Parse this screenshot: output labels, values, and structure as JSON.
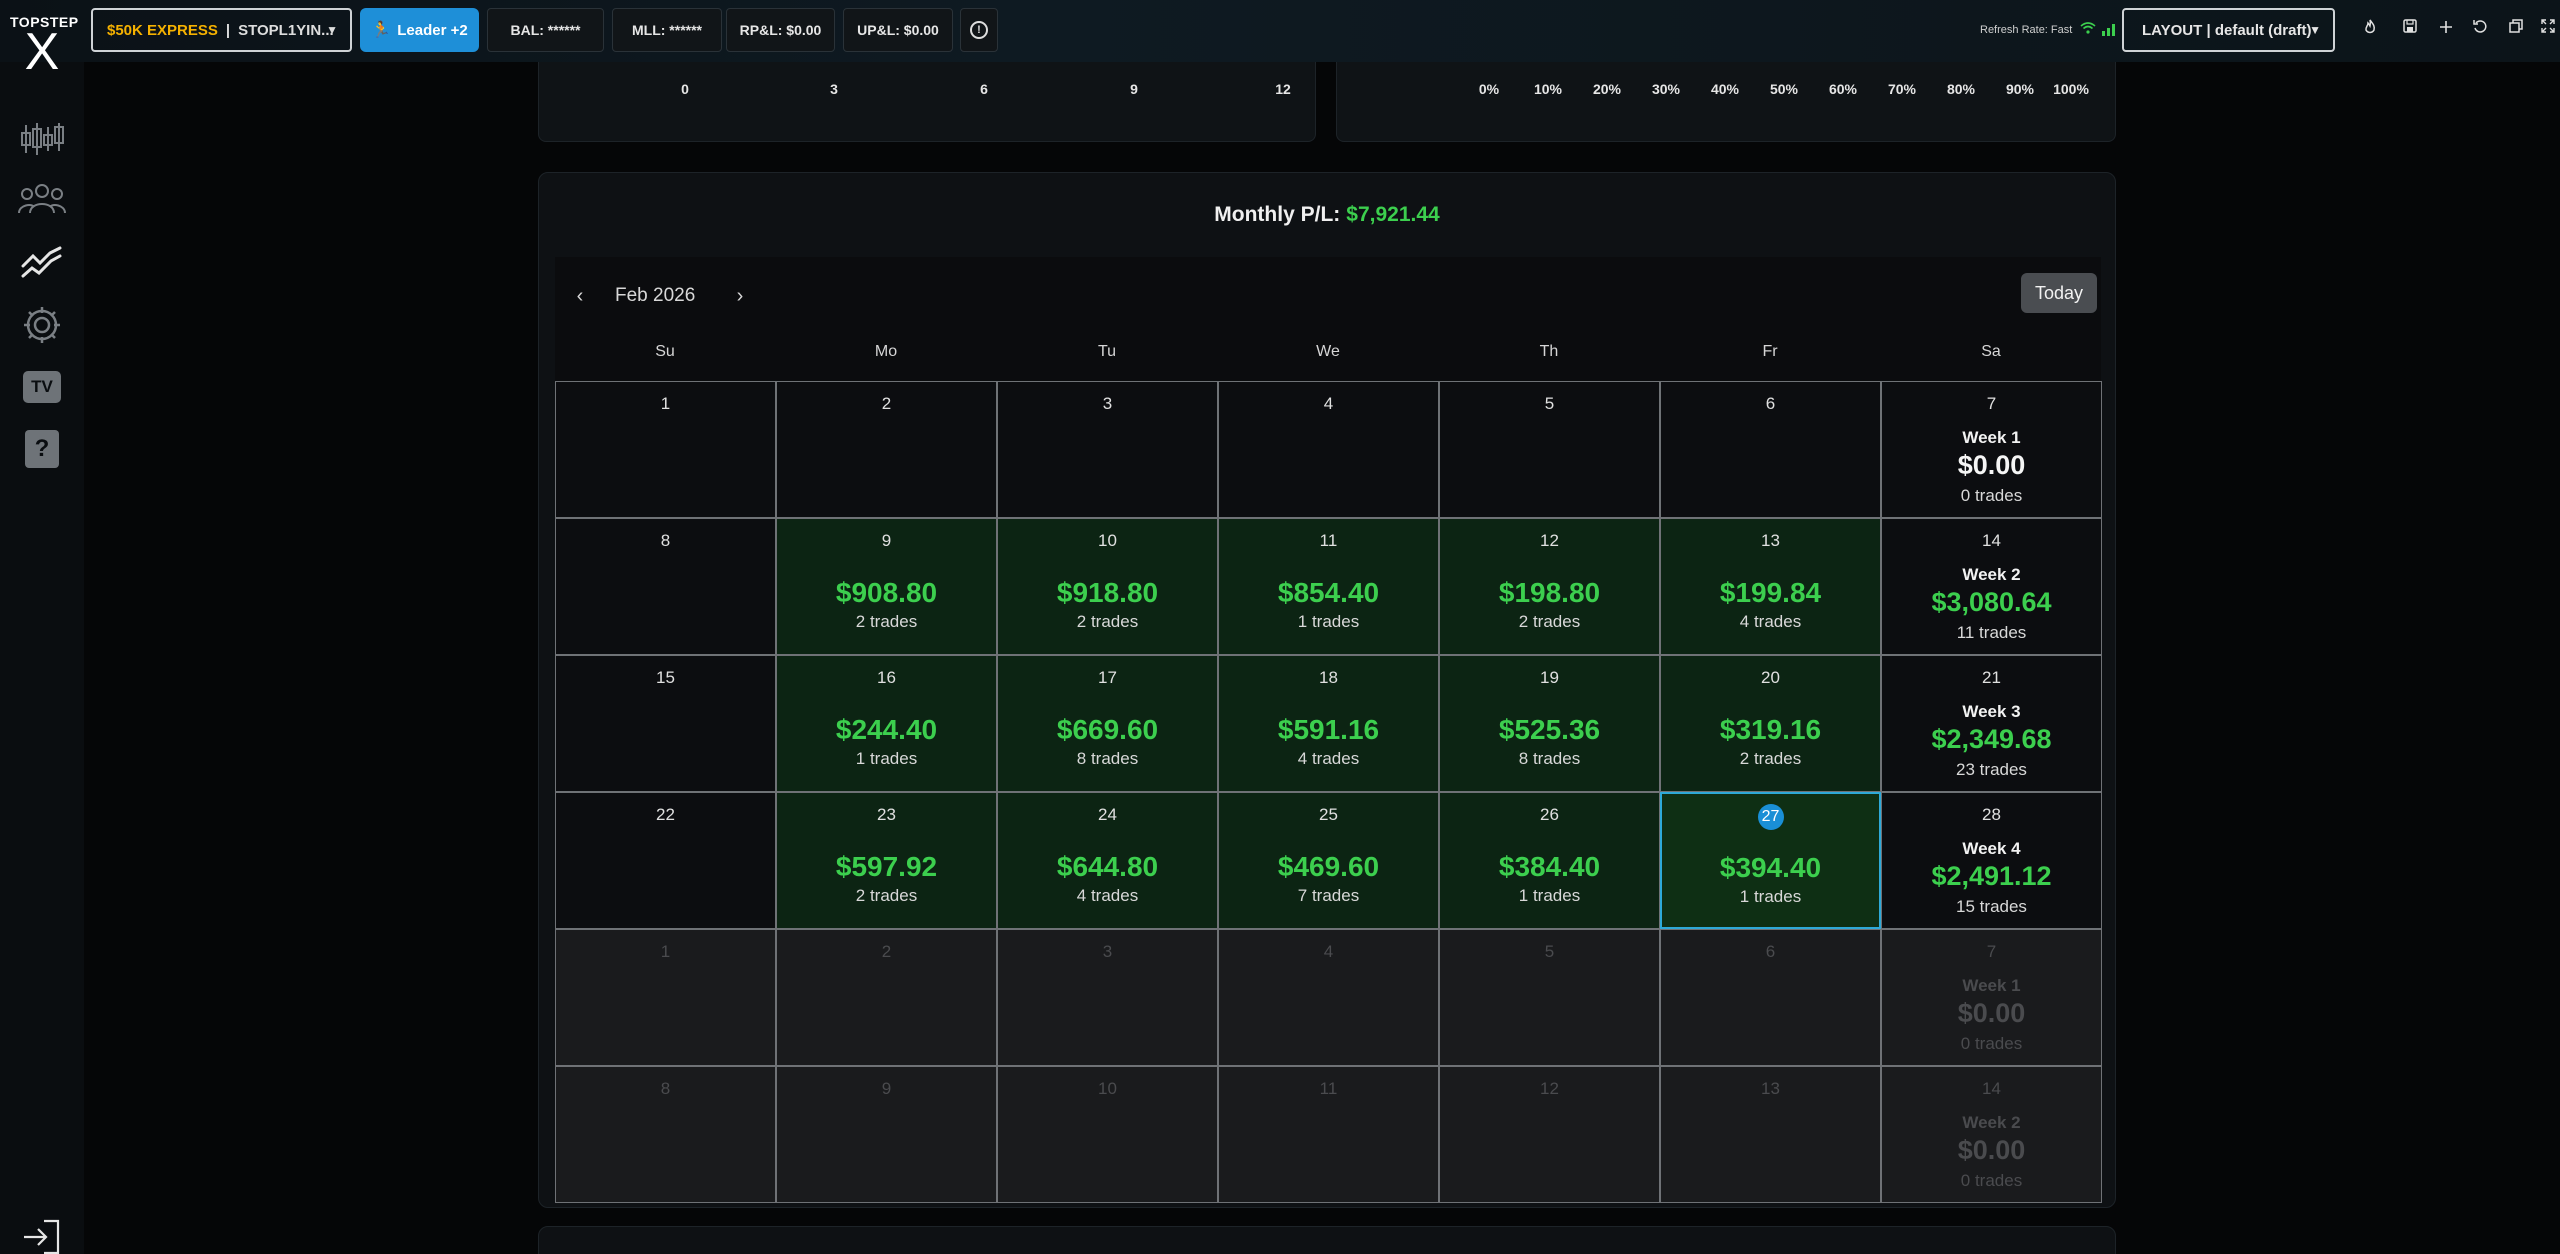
{
  "brand": {
    "name": "TOPSTEP",
    "mark": "X"
  },
  "topbar": {
    "account_type": "$50K EXPRESS",
    "account_sep": "|",
    "account_id": "STOPL1YIN...",
    "leader_label": "Leader +2",
    "bal": "BAL: ******",
    "mll": "MLL: ******",
    "rpl": "RP&L: $0.00",
    "upl": "UP&L: $0.00",
    "info": "!",
    "refresh_label": "Refresh Rate: Fast",
    "layout_label": "LAYOUT | default (draft)"
  },
  "icons": {
    "sidebar": [
      "chart-candles-icon",
      "users-icon",
      "stats-icon",
      "gear-icon",
      "tv-icon",
      "help-icon",
      "logout-icon"
    ],
    "toolbar": [
      "flame-icon",
      "save-icon",
      "plus-icon",
      "undo-icon",
      "windows-icon",
      "fullscreen-icon"
    ]
  },
  "sidebar": {
    "tv_label": "TV",
    "help_label": "?"
  },
  "top_cards": {
    "left_ticks": [
      "0",
      "3",
      "6",
      "9",
      "12"
    ],
    "right_ticks": [
      "0%",
      "10%",
      "20%",
      "30%",
      "40%",
      "50%",
      "60%",
      "70%",
      "80%",
      "90%",
      "100%"
    ]
  },
  "calendar": {
    "monthly_label": "Monthly P/L:",
    "monthly_value": "$7,921.44",
    "month": "Feb 2026",
    "prev": "‹",
    "next": "›",
    "today_label": "Today",
    "weekdays": [
      "Su",
      "Mo",
      "Tu",
      "We",
      "Th",
      "Fr",
      "Sa"
    ],
    "weeks": [
      {
        "days": [
          {
            "day": "1"
          },
          {
            "day": "2"
          },
          {
            "day": "3"
          },
          {
            "day": "4"
          },
          {
            "day": "5"
          },
          {
            "day": "6"
          }
        ],
        "summary": {
          "day": "7",
          "label": "Week 1",
          "pl": "$0.00",
          "trades": "0 trades"
        }
      },
      {
        "days": [
          {
            "day": "8"
          },
          {
            "day": "9",
            "pl": "$908.80",
            "trades": "2 trades"
          },
          {
            "day": "10",
            "pl": "$918.80",
            "trades": "2 trades"
          },
          {
            "day": "11",
            "pl": "$854.40",
            "trades": "1 trades"
          },
          {
            "day": "12",
            "pl": "$198.80",
            "trades": "2 trades"
          },
          {
            "day": "13",
            "pl": "$199.84",
            "trades": "4 trades"
          }
        ],
        "summary": {
          "day": "14",
          "label": "Week 2",
          "pl": "$3,080.64",
          "trades": "11 trades"
        }
      },
      {
        "days": [
          {
            "day": "15"
          },
          {
            "day": "16",
            "pl": "$244.40",
            "trades": "1 trades"
          },
          {
            "day": "17",
            "pl": "$669.60",
            "trades": "8 trades"
          },
          {
            "day": "18",
            "pl": "$591.16",
            "trades": "4 trades"
          },
          {
            "day": "19",
            "pl": "$525.36",
            "trades": "8 trades"
          },
          {
            "day": "20",
            "pl": "$319.16",
            "trades": "2 trades"
          }
        ],
        "summary": {
          "day": "21",
          "label": "Week 3",
          "pl": "$2,349.68",
          "trades": "23 trades"
        }
      },
      {
        "days": [
          {
            "day": "22"
          },
          {
            "day": "23",
            "pl": "$597.92",
            "trades": "2 trades"
          },
          {
            "day": "24",
            "pl": "$644.80",
            "trades": "4 trades"
          },
          {
            "day": "25",
            "pl": "$469.60",
            "trades": "7 trades"
          },
          {
            "day": "26",
            "pl": "$384.40",
            "trades": "1 trades"
          },
          {
            "day": "27",
            "pl": "$394.40",
            "trades": "1 trades",
            "today": true
          }
        ],
        "summary": {
          "day": "28",
          "label": "Week 4",
          "pl": "$2,491.12",
          "trades": "15 trades"
        }
      },
      {
        "faded": true,
        "days": [
          {
            "day": "1"
          },
          {
            "day": "2"
          },
          {
            "day": "3"
          },
          {
            "day": "4"
          },
          {
            "day": "5"
          },
          {
            "day": "6"
          }
        ],
        "summary": {
          "day": "7",
          "label": "Week 1",
          "pl": "$0.00",
          "trades": "0 trades"
        }
      },
      {
        "faded": true,
        "days": [
          {
            "day": "8"
          },
          {
            "day": "9"
          },
          {
            "day": "10"
          },
          {
            "day": "11"
          },
          {
            "day": "12"
          },
          {
            "day": "13"
          }
        ],
        "summary": {
          "day": "14",
          "label": "Week 2",
          "pl": "$0.00",
          "trades": "0 trades"
        }
      }
    ]
  },
  "colors": {
    "profit": "#3ccf4e",
    "accent": "#1e8fd8",
    "today_border": "#2ea9d8",
    "account_type": "#f5b100"
  }
}
